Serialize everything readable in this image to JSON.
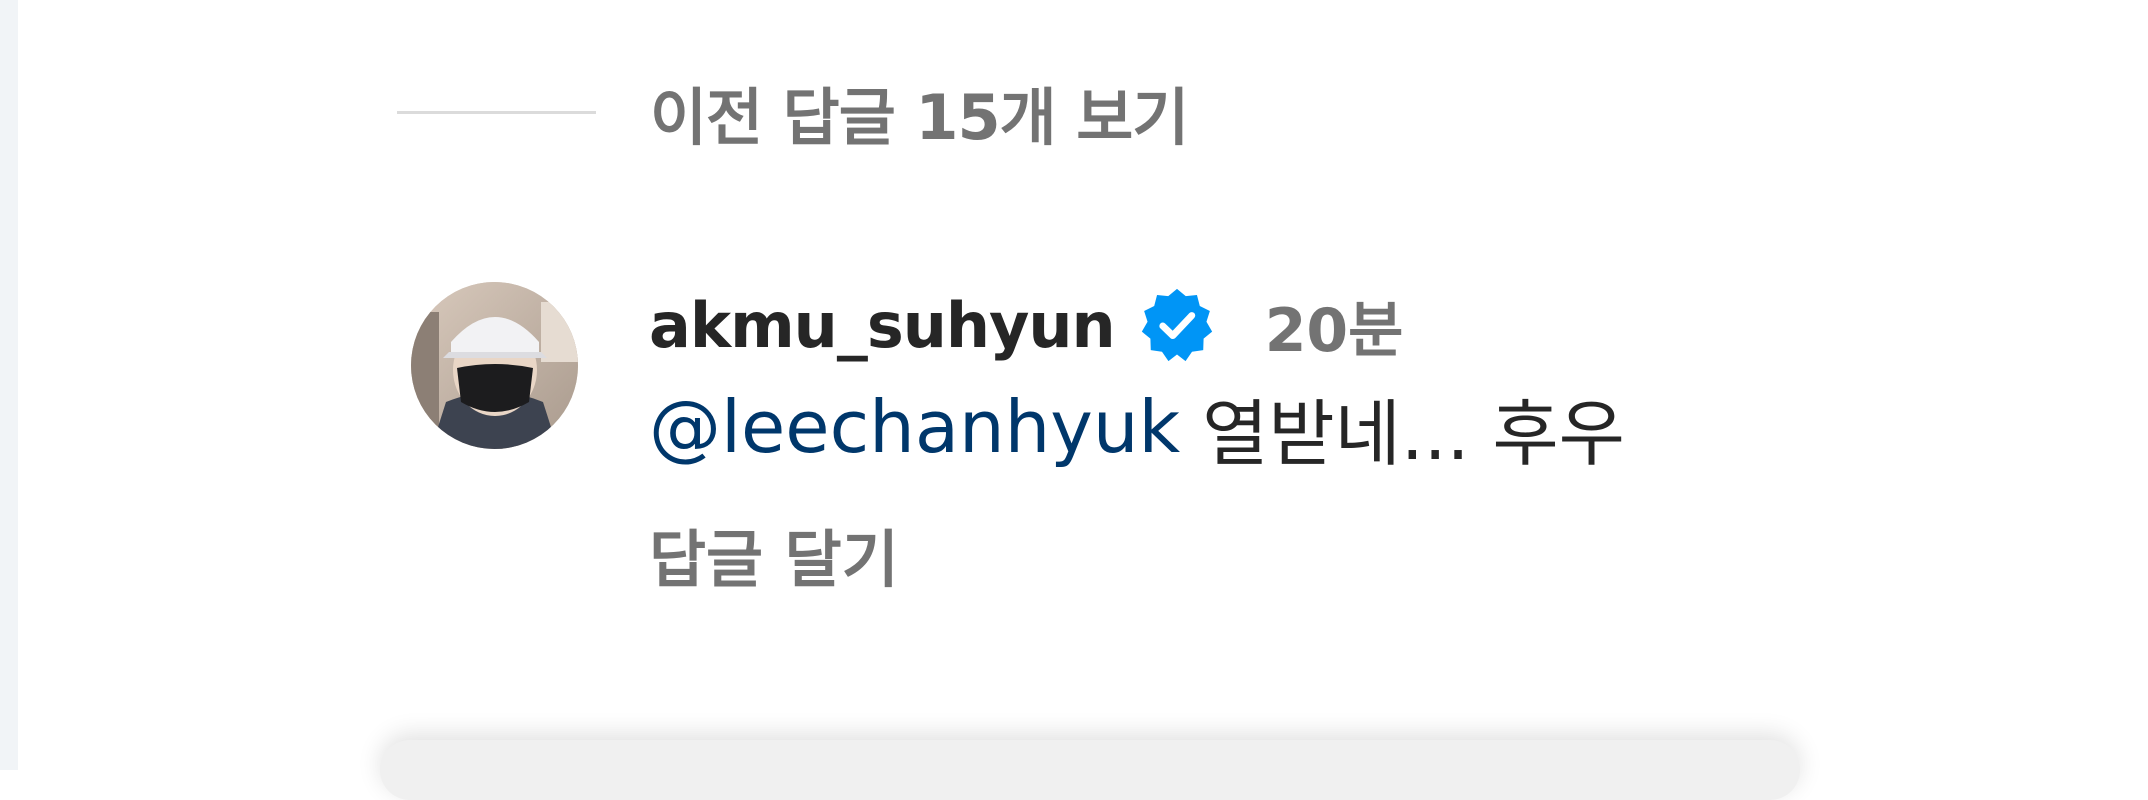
{
  "replies": {
    "view_previous_label": "이전 답글 15개 보기"
  },
  "comment": {
    "username": "akmu_suhyun",
    "verified": true,
    "time": "20분",
    "mention": "@leechanhyuk",
    "message": "열받네... 후우",
    "reply_label": "답글 달기"
  },
  "colors": {
    "verified_badge": "#0095f6",
    "mention_link": "#00376b",
    "secondary_text": "#737373",
    "primary_text": "#262626"
  }
}
